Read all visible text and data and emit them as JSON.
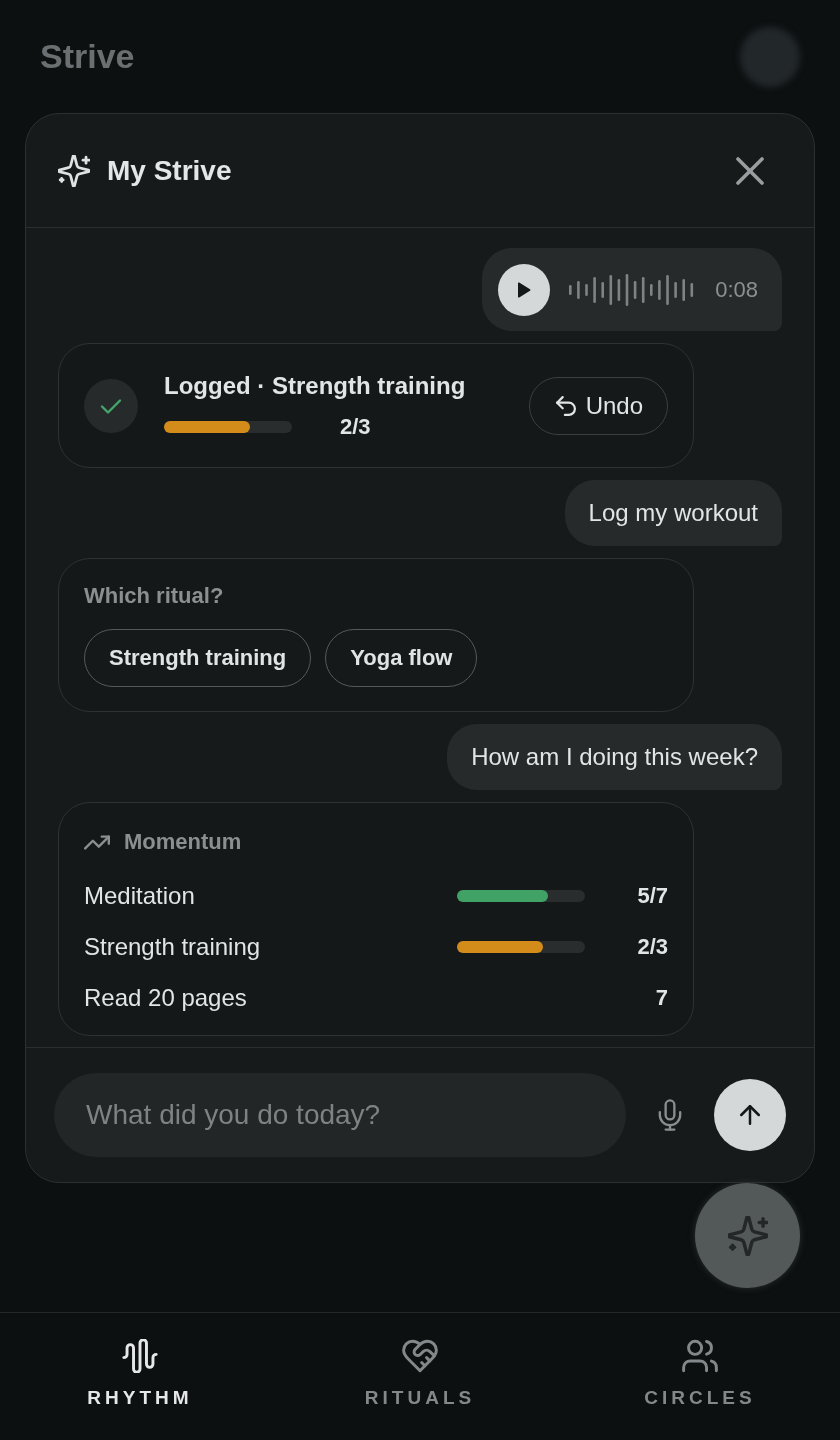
{
  "background": {
    "title": "Strive"
  },
  "panel": {
    "title": "My Strive"
  },
  "messages": [
    {
      "kind": "voice",
      "duration": "0:08"
    },
    {
      "kind": "logged",
      "title": "Logged · Strength training",
      "level": 0.67,
      "progress": "2/3",
      "action": "Undo"
    },
    {
      "kind": "user",
      "text": "Log my workout"
    },
    {
      "kind": "choice",
      "prompt": "Which ritual?",
      "options": [
        {
          "label": "Strength training"
        },
        {
          "label": "Yoga flow"
        }
      ]
    },
    {
      "kind": "user",
      "text": "How am I doing this week?"
    },
    {
      "kind": "momentum",
      "title": "Momentum",
      "rows": [
        {
          "kind": "bar",
          "label": "Meditation",
          "level": 0.71,
          "color": "#41a266",
          "value": "5/7"
        },
        {
          "kind": "bar",
          "label": "Strength training",
          "level": 0.67,
          "color": "#d38b1a",
          "value": "2/3"
        },
        {
          "kind": "count",
          "label": "Read 20 pages",
          "value": "7"
        }
      ]
    }
  ],
  "composer": {
    "placeholder": "What did you do today?"
  },
  "nav": [
    {
      "label": "RHYTHM",
      "selected": true
    },
    {
      "label": "RITUALS",
      "selected": false
    },
    {
      "label": "CIRCLES",
      "selected": false
    }
  ]
}
